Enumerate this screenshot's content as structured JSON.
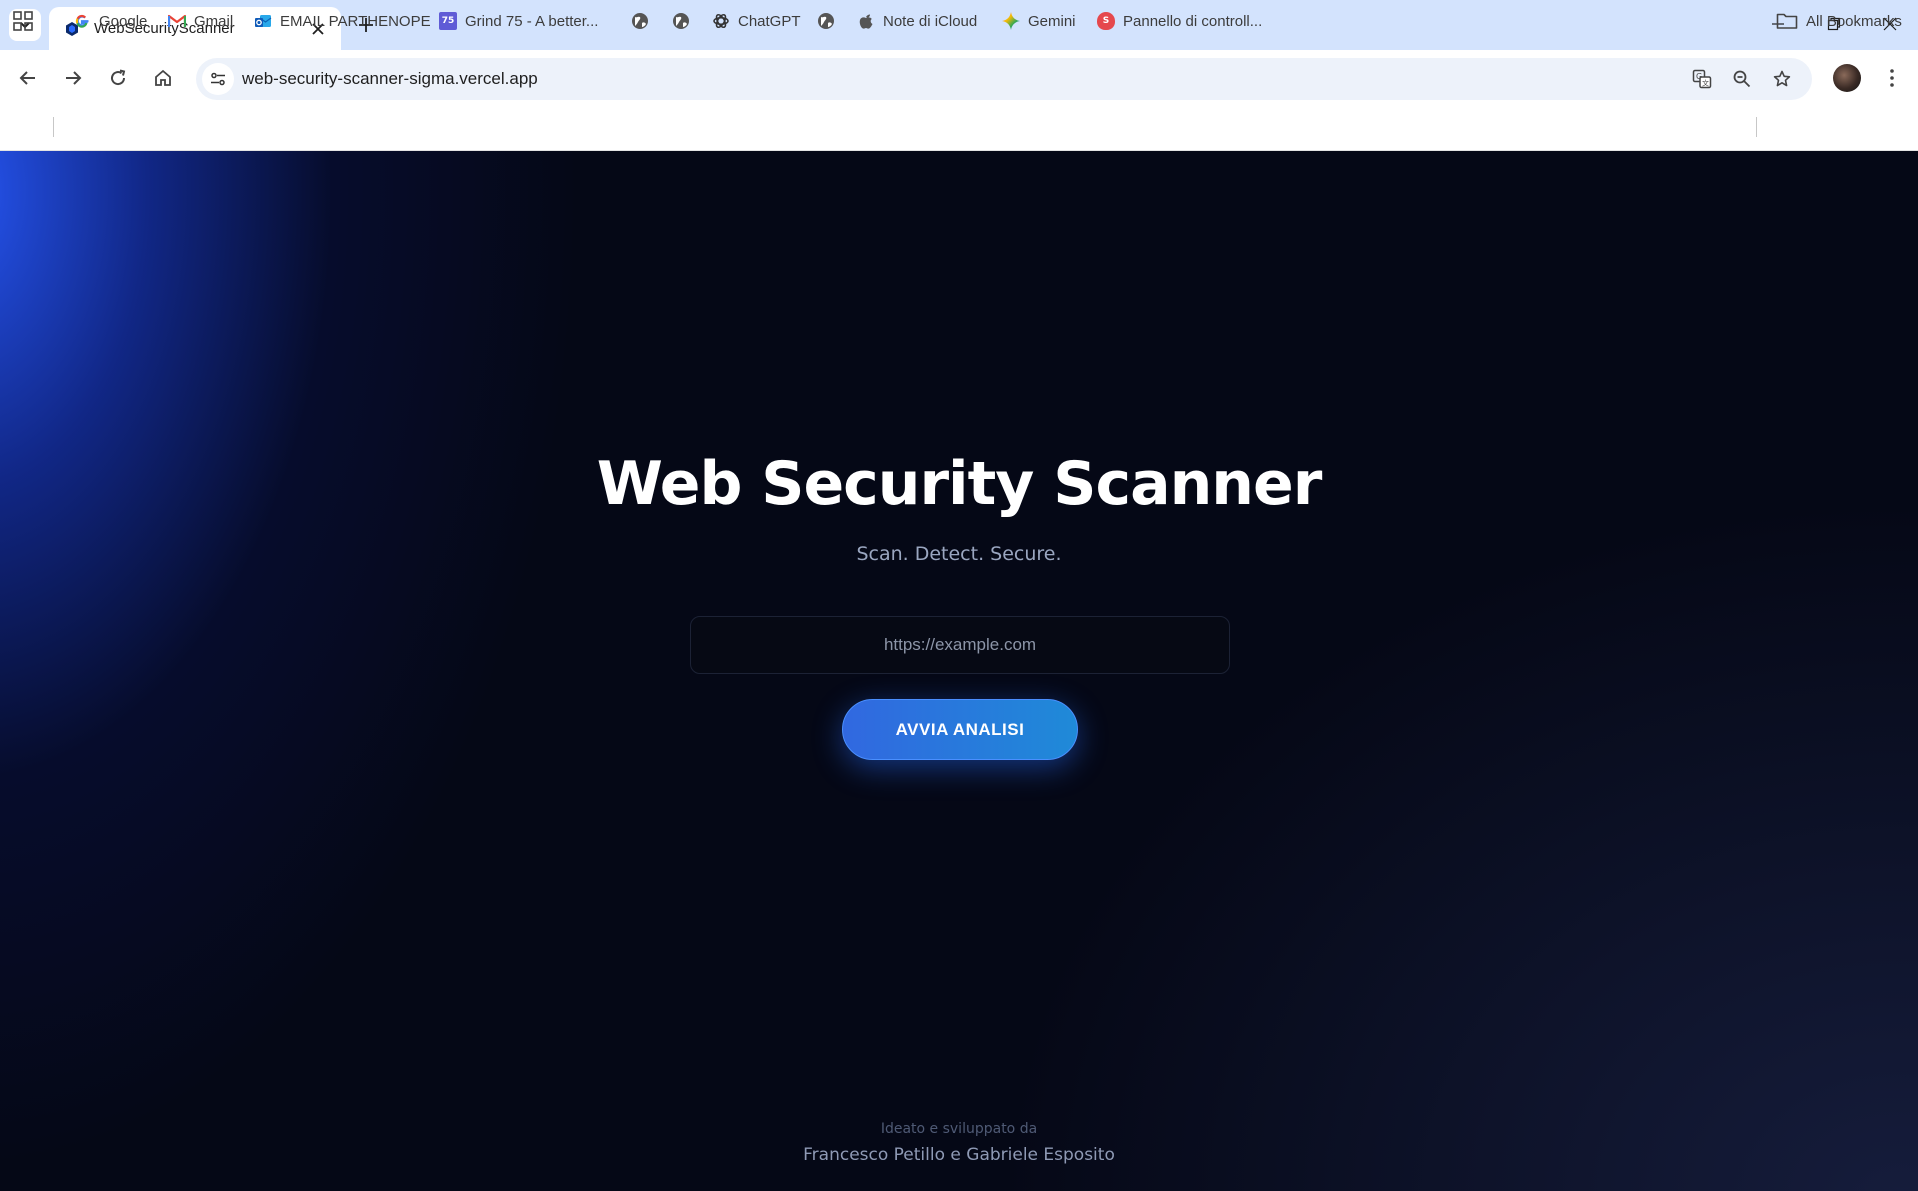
{
  "browser": {
    "tab": {
      "title": "WebSecurityScanner",
      "favicon": "shield-hex-icon"
    },
    "address_bar": {
      "url": "web-security-scanner-sigma.vercel.app"
    },
    "bookmarks": [
      {
        "label": "Google",
        "icon": "google-icon"
      },
      {
        "label": "Gmail",
        "icon": "gmail-icon"
      },
      {
        "label": "EMAIL PARTHENOPE",
        "icon": "outlook-icon"
      },
      {
        "label": "Grind 75 - A better...",
        "icon": "grind75-icon",
        "icon_text": "75"
      },
      {
        "label": "",
        "icon": "globe-icon"
      },
      {
        "label": "",
        "icon": "globe-icon"
      },
      {
        "label": "ChatGPT",
        "icon": "chatgpt-icon"
      },
      {
        "label": "",
        "icon": "globe-icon"
      },
      {
        "label": "Note di iCloud",
        "icon": "apple-icon"
      },
      {
        "label": "Gemini",
        "icon": "gemini-icon"
      },
      {
        "label": "Pannello di controll...",
        "icon": "red-badge-icon",
        "icon_text": "S"
      }
    ],
    "all_bookmarks_label": "All Bookmarks"
  },
  "page": {
    "title": "Web Security Scanner",
    "subtitle": "Scan. Detect. Secure.",
    "url_input": {
      "placeholder": "https://example.com",
      "value": ""
    },
    "scan_button_label": "AVVIA ANALISI",
    "footer": {
      "label": "Ideato e sviluppato da",
      "authors": "Francesco Petillo e Gabriele Esposito"
    }
  },
  "colors": {
    "background": "#050816",
    "accent_glow": "#2a5cff",
    "button_start": "#3168e0",
    "button_end": "#1f8ad8",
    "subtitle": "#9aa6c0"
  }
}
